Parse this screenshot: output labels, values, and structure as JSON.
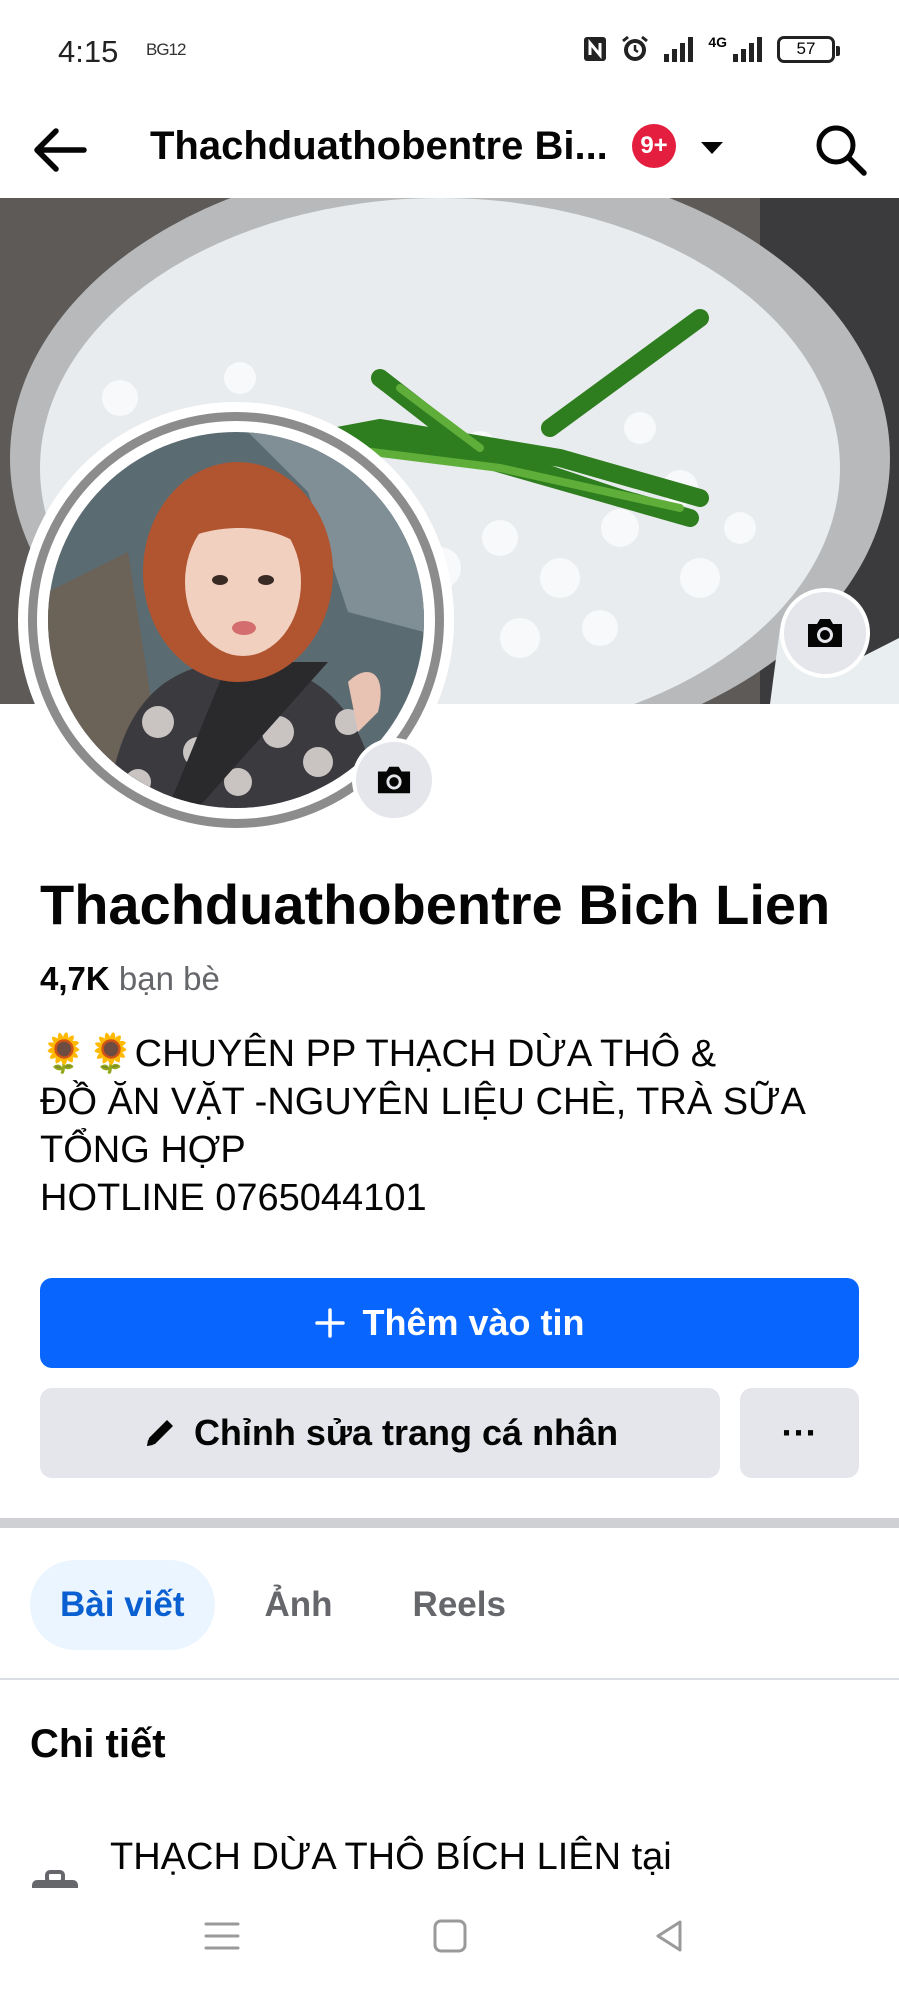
{
  "status_bar": {
    "time": "4:15",
    "small_icon_text": "BG12",
    "battery": "57",
    "network": "4G"
  },
  "top_nav": {
    "title": "Thachduathobentre Bi...",
    "notification_badge": "9+",
    "icons": [
      "back-arrow-icon",
      "caret-down-icon",
      "search-icon"
    ]
  },
  "profile": {
    "name": "Thachduathobentre Bich Lien",
    "friends_count": "4,7K",
    "friends_label": "bạn bè",
    "bio_lines": [
      "🌻🌻CHUYÊN PP THẠCH DỪA THÔ &",
      "ĐỒ ĂN VẶT -NGUYÊN LIỆU CHÈ, TRÀ SỮA",
      "TỔNG HỢP",
      "HOTLINE 0765044101"
    ]
  },
  "actions": {
    "add_story": "Thêm vào tin",
    "edit_profile": "Chỉnh sửa trang cá nhân",
    "more": "···"
  },
  "tabs": [
    {
      "label": "Bài viết",
      "active": true
    },
    {
      "label": "Ảnh",
      "active": false
    },
    {
      "label": "Reels",
      "active": false
    }
  ],
  "details": {
    "title": "Chi tiết",
    "work": "THẠCH DỪA THÔ BÍCH LIÊN tại"
  },
  "colors": {
    "primary": "#0866ff",
    "secondary_button": "#e4e6eb",
    "badge": "#e41e3f",
    "active_tab_bg": "#ebf5ff",
    "active_tab_text": "#0a5fd1"
  }
}
